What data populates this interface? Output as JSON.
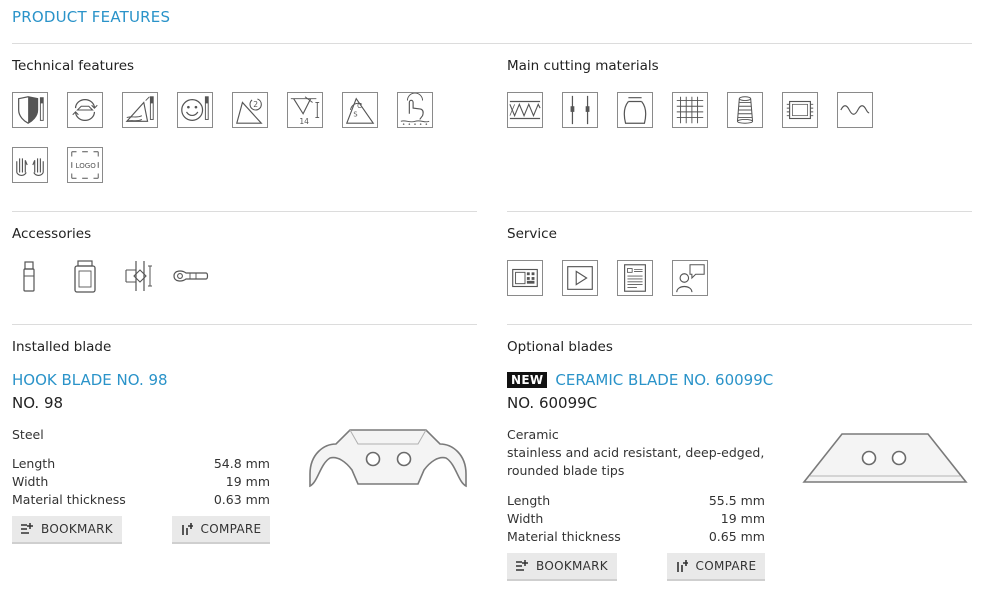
{
  "page_title": "PRODUCT FEATURES",
  "technical_features": {
    "title": "Technical features",
    "icons": [
      "safety-shield-icon",
      "hand-protection-icon",
      "cutting-depth-icon",
      "ergonomic-icon",
      "blade-change-icon",
      "cutting-depth-14-icon",
      "auto-retract-icon",
      "touch-icon",
      "ambidextrous-icon",
      "logo-print-icon"
    ],
    "logo_label": "LOGO",
    "depth_label": "14"
  },
  "main_cutting_materials": {
    "title": "Main cutting materials",
    "icons": [
      "corrugated-cardboard-icon",
      "strapping-icon",
      "bag-icon",
      "fabric-icon",
      "roll-icon",
      "film-icon",
      "foil-icon"
    ]
  },
  "accessories": {
    "title": "Accessories",
    "icons": [
      "blade-holder-icon",
      "blade-dispenser-icon",
      "belt-holster-icon",
      "lanyard-icon"
    ]
  },
  "service": {
    "title": "Service",
    "icons": [
      "video-gallery-icon",
      "play-video-icon",
      "datasheet-icon",
      "contact-person-icon"
    ]
  },
  "installed_blade": {
    "section_title": "Installed blade",
    "name": "HOOK BLADE NO. 98",
    "number": "NO. 98",
    "material": "Steel",
    "specs": [
      {
        "label": "Length",
        "value": "54.8 mm"
      },
      {
        "label": "Width",
        "value": "19 mm"
      },
      {
        "label": "Material thickness",
        "value": "0.63 mm"
      }
    ],
    "bookmark_label": "BOOKMARK",
    "compare_label": "COMPARE"
  },
  "optional_blades": {
    "section_title": "Optional blades",
    "badge": "NEW",
    "name": "CERAMIC BLADE NO. 60099C",
    "number": "NO. 60099C",
    "material": "Ceramic",
    "description_line1": "stainless and acid resistant, deep-edged,",
    "description_line2": "rounded blade tips",
    "specs": [
      {
        "label": "Length",
        "value": "55.5 mm"
      },
      {
        "label": "Width",
        "value": "19 mm"
      },
      {
        "label": "Material thickness",
        "value": "0.65 mm"
      }
    ],
    "bookmark_label": "BOOKMARK",
    "compare_label": "COMPARE"
  },
  "colors": {
    "accent": "#2a93c9",
    "text": "#222222",
    "rule": "#dcdcdc",
    "button_bg": "#e9e9e9",
    "badge_bg": "#111111"
  }
}
